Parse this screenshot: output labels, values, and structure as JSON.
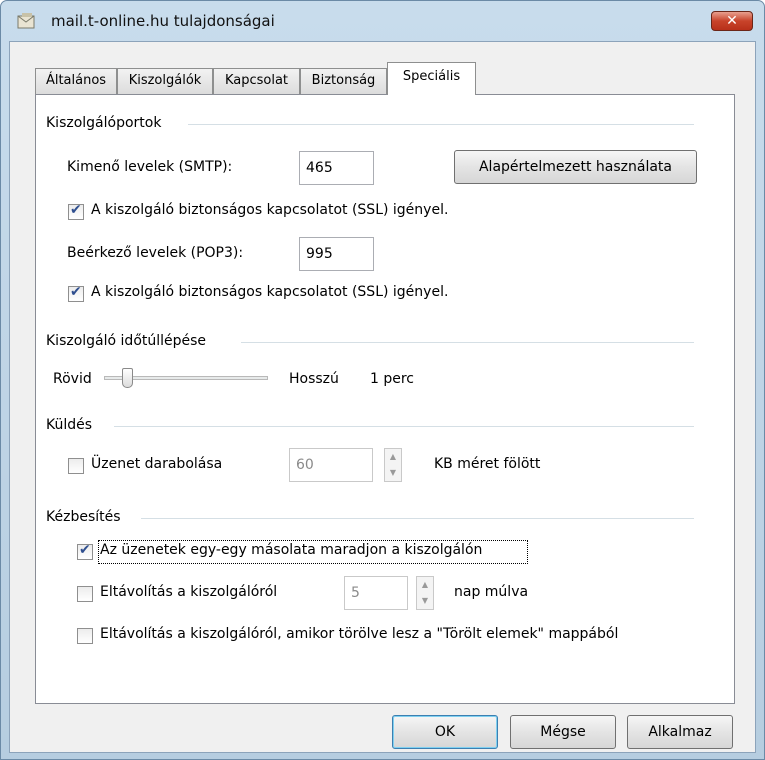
{
  "window": {
    "title": "mail.t-online.hu tulajdonságai",
    "close_label": "✕"
  },
  "tabs": [
    {
      "label": "Általános"
    },
    {
      "label": "Kiszolgálók"
    },
    {
      "label": "Kapcsolat"
    },
    {
      "label": "Biztonság"
    },
    {
      "label": "Speciális",
      "active": true
    }
  ],
  "ports": {
    "group_title": "Kiszolgálóportok",
    "smtp_label": "Kimenő levelek (SMTP):",
    "smtp_value": "465",
    "default_button": "Alapértelmezett használata",
    "smtp_ssl_label": "A kiszolgáló biztonságos kapcsolatot (SSL) igényel.",
    "smtp_ssl_checked": true,
    "pop3_label": "Beérkező levelek (POP3):",
    "pop3_value": "995",
    "pop3_ssl_label": "A kiszolgáló biztonságos kapcsolatot (SSL) igényel.",
    "pop3_ssl_checked": true
  },
  "timeout": {
    "group_title": "Kiszolgáló időtúllépése",
    "short_label": "Rövid",
    "long_label": "Hosszú",
    "value_text": "1 perc",
    "slider_fraction": 0.12
  },
  "sending": {
    "group_title": "Küldés",
    "split_label": "Üzenet darabolása",
    "split_checked": false,
    "size_value": "60",
    "unit_label": "KB méret fölött"
  },
  "delivery": {
    "group_title": "Kézbesítés",
    "keep_copy_label": "Az üzenetek egy-egy másolata maradjon a kiszolgálón",
    "keep_copy_checked": true,
    "remove_after_label": "Eltávolítás a kiszolgálóról",
    "remove_after_checked": false,
    "days_value": "5",
    "days_unit_label": "nap múlva",
    "remove_deleted_label": "Eltávolítás a kiszolgálóról, amikor törölve lesz a \"Törölt elemek\" mappából",
    "remove_deleted_checked": false
  },
  "footer": {
    "ok_label": "OK",
    "cancel_label": "Mégse",
    "apply_label": "Alkalmaz"
  }
}
